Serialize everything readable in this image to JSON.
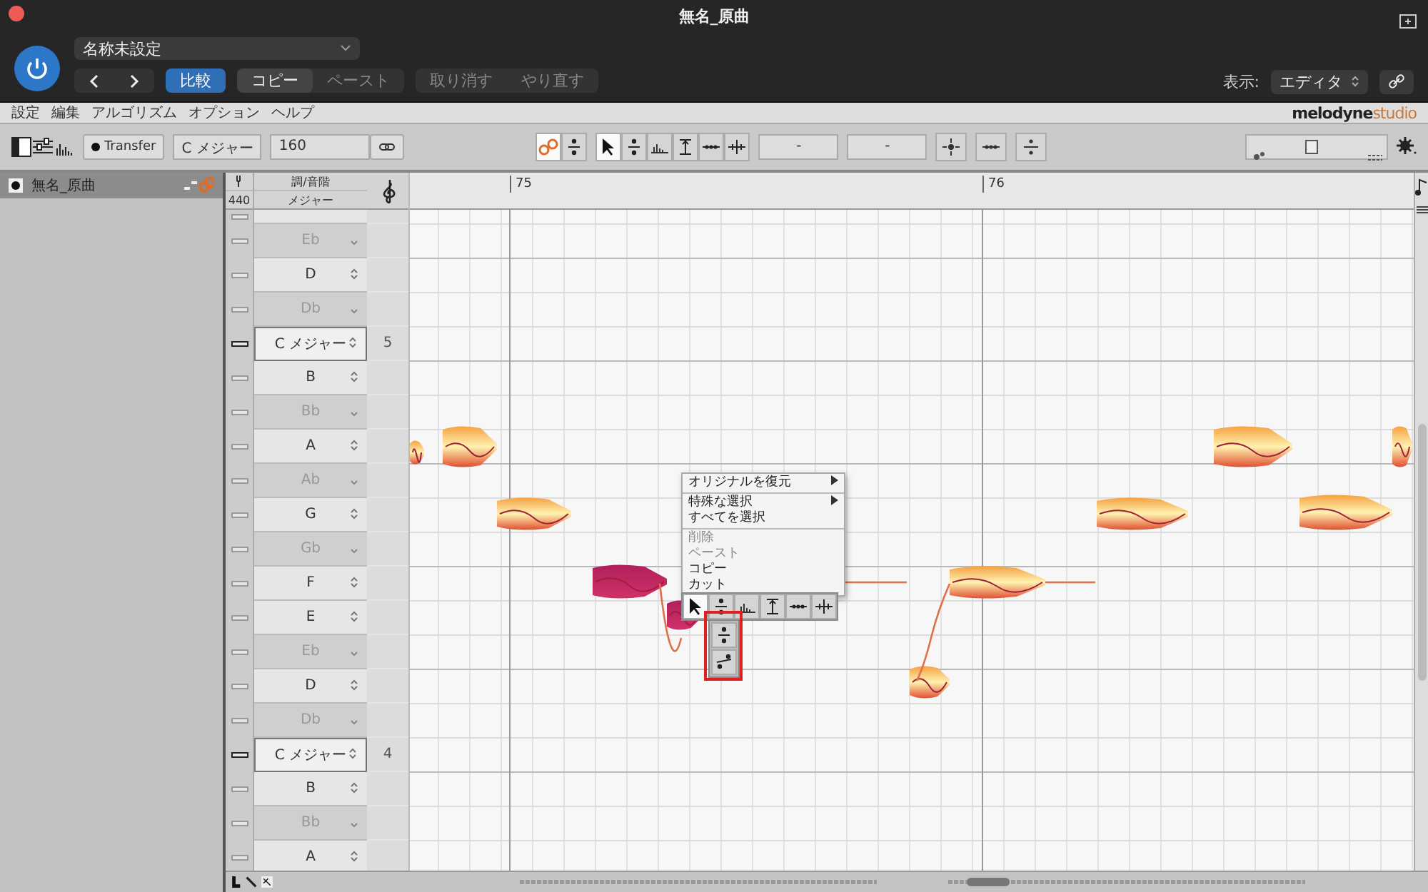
{
  "window": {
    "title": "無名_原曲"
  },
  "header": {
    "preset": "名称未設定",
    "compare": {
      "label": "比較",
      "selected": true
    },
    "edit_buttons": [
      {
        "label": "コピー",
        "disabled": false
      },
      {
        "label": "ペースト",
        "disabled": true
      }
    ],
    "history_buttons": [
      {
        "label": "取り消す",
        "disabled": true
      },
      {
        "label": "やり直す",
        "disabled": true
      }
    ],
    "view_label": "表示:",
    "view_value": "エディタ"
  },
  "menu_bar": [
    "設定",
    "編集",
    "アルゴリズム",
    "オプション",
    "ヘルプ"
  ],
  "logo": {
    "name": "melodyne",
    "edition": "studio"
  },
  "toolbar": {
    "transfer": "Transfer",
    "key": "C メジャー",
    "tempo": "160",
    "modes": [
      {
        "kind": "blob",
        "selected": true
      },
      {
        "kind": "pitch",
        "selected": false
      }
    ],
    "tools": [
      {
        "kind": "pointer",
        "selected": true
      },
      {
        "kind": "pitch",
        "selected": false
      },
      {
        "kind": "formant",
        "selected": false
      },
      {
        "kind": "amplitude",
        "selected": false
      },
      {
        "kind": "timing",
        "selected": false
      },
      {
        "kind": "separation",
        "selected": false
      }
    ],
    "fields": [
      "-",
      "-"
    ],
    "zoom": {
      "level": 0.45
    }
  },
  "tracks": [
    {
      "name": "無名_原曲",
      "selected": true
    }
  ],
  "pitch_ruler": {
    "reference": "440",
    "heading": "調/音階",
    "scale": "メジャー",
    "rows": [
      {
        "kind": "natural"
      },
      {
        "kind": "accidental",
        "label": "Eb"
      },
      {
        "kind": "natural",
        "label": "D"
      },
      {
        "kind": "accidental",
        "label": "Db"
      },
      {
        "kind": "key",
        "label": "C メジャー",
        "octave": "5"
      },
      {
        "kind": "natural",
        "label": "B"
      },
      {
        "kind": "accidental",
        "label": "Bb"
      },
      {
        "kind": "natural",
        "label": "A"
      },
      {
        "kind": "accidental",
        "label": "Ab"
      },
      {
        "kind": "natural",
        "label": "G"
      },
      {
        "kind": "accidental",
        "label": "Gb"
      },
      {
        "kind": "natural",
        "label": "F"
      },
      {
        "kind": "natural",
        "label": "E"
      },
      {
        "kind": "accidental",
        "label": "Eb"
      },
      {
        "kind": "natural",
        "label": "D"
      },
      {
        "kind": "accidental",
        "label": "Db"
      },
      {
        "kind": "key",
        "label": "C メジャー",
        "octave": "4"
      },
      {
        "kind": "natural",
        "label": "B"
      },
      {
        "kind": "accidental",
        "label": "Bb"
      },
      {
        "kind": "natural",
        "label": "A"
      }
    ]
  },
  "timeline": {
    "bars": [
      "75",
      "76"
    ]
  },
  "context_menu": {
    "items": [
      {
        "label": "オリジナルを復元",
        "submenu": true,
        "disabled": false,
        "separator_before": false
      },
      {
        "label": "特殊な選択",
        "submenu": true,
        "disabled": false,
        "separator_before": true
      },
      {
        "label": "すべてを選択",
        "submenu": false,
        "disabled": false,
        "separator_before": false
      },
      {
        "label": "削除",
        "submenu": false,
        "disabled": true,
        "separator_before": true
      },
      {
        "label": "ペースト",
        "submenu": false,
        "disabled": true,
        "separator_before": false
      },
      {
        "label": "コピー",
        "submenu": false,
        "disabled": false,
        "separator_before": false
      },
      {
        "label": "カット",
        "submenu": false,
        "disabled": false,
        "separator_before": false
      }
    ]
  },
  "tool_popup": {
    "tools": [
      {
        "kind": "pointer",
        "selected": true
      },
      {
        "kind": "pitch",
        "selected": false
      },
      {
        "kind": "formant",
        "selected": false
      },
      {
        "kind": "amplitude",
        "selected": false
      },
      {
        "kind": "timing",
        "selected": false
      },
      {
        "kind": "separation",
        "selected": false
      }
    ],
    "sub_tools": [
      {
        "kind": "pitch",
        "selected": false
      },
      {
        "kind": "pitch_drift",
        "selected": false
      }
    ],
    "highlighted": true
  }
}
